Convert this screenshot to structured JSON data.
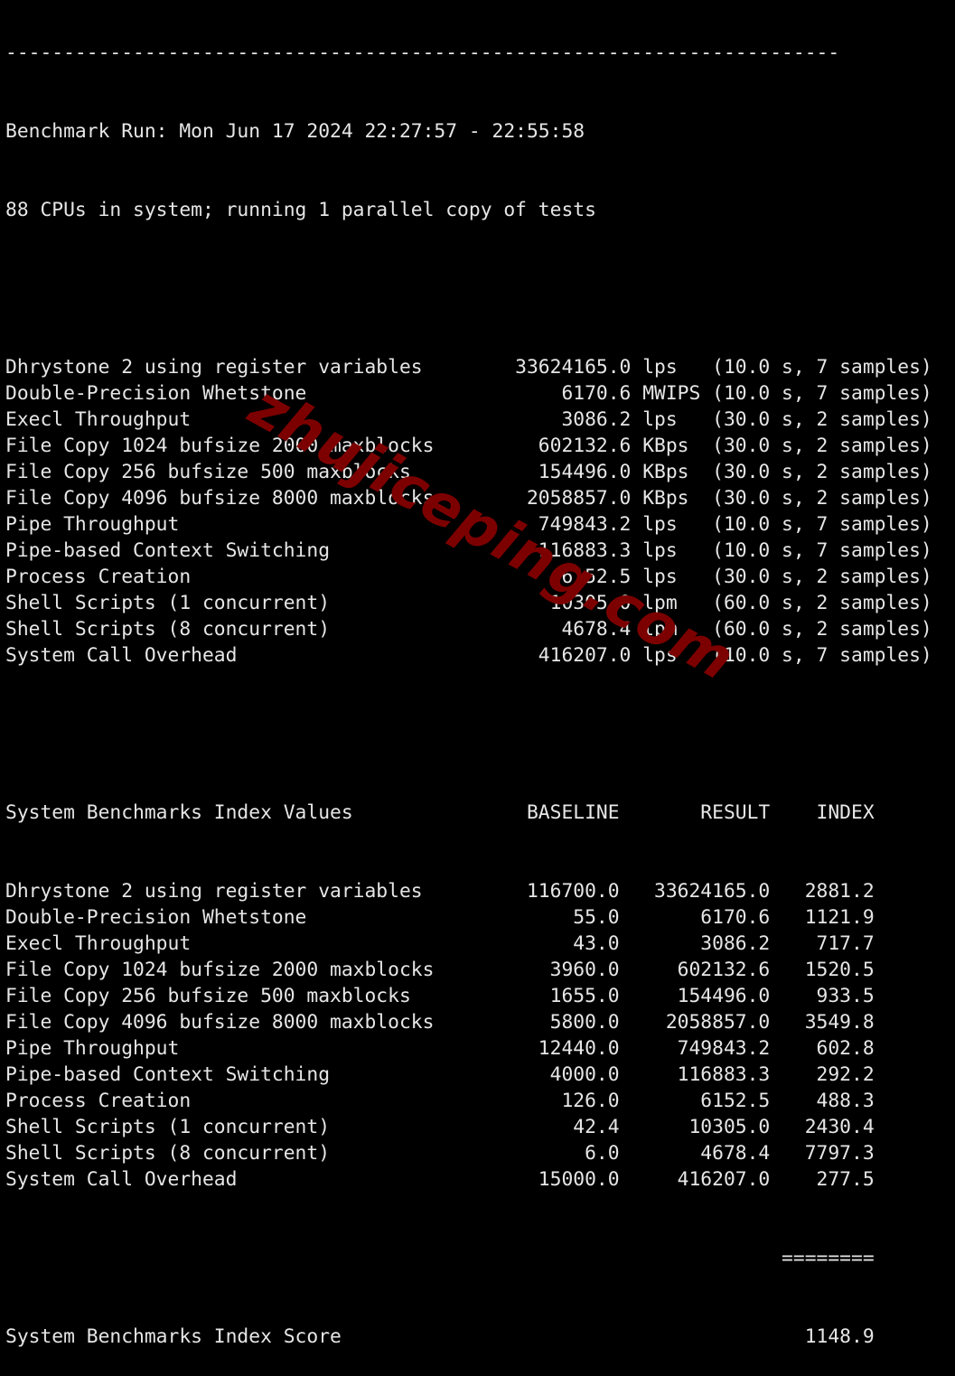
{
  "separator": "------------------------------------------------------------------------",
  "header": {
    "run_line": "Benchmark Run: Mon Jun 17 2024 22:27:57 - 22:55:58",
    "cpu_line": "88 CPUs in system; running 1 parallel copy of tests"
  },
  "raw_results": [
    {
      "name": "Dhrystone 2 using register variables",
      "value": "33624165.0",
      "unit": "lps",
      "time": "10.0 s",
      "samples": "7 samples"
    },
    {
      "name": "Double-Precision Whetstone",
      "value": "6170.6",
      "unit": "MWIPS",
      "time": "10.0 s",
      "samples": "7 samples"
    },
    {
      "name": "Execl Throughput",
      "value": "3086.2",
      "unit": "lps",
      "time": "30.0 s",
      "samples": "2 samples"
    },
    {
      "name": "File Copy 1024 bufsize 2000 maxblocks",
      "value": "602132.6",
      "unit": "KBps",
      "time": "30.0 s",
      "samples": "2 samples"
    },
    {
      "name": "File Copy 256 bufsize 500 maxblocks",
      "value": "154496.0",
      "unit": "KBps",
      "time": "30.0 s",
      "samples": "2 samples"
    },
    {
      "name": "File Copy 4096 bufsize 8000 maxblocks",
      "value": "2058857.0",
      "unit": "KBps",
      "time": "30.0 s",
      "samples": "2 samples"
    },
    {
      "name": "Pipe Throughput",
      "value": "749843.2",
      "unit": "lps",
      "time": "10.0 s",
      "samples": "7 samples"
    },
    {
      "name": "Pipe-based Context Switching",
      "value": "116883.3",
      "unit": "lps",
      "time": "10.0 s",
      "samples": "7 samples"
    },
    {
      "name": "Process Creation",
      "value": "6152.5",
      "unit": "lps",
      "time": "30.0 s",
      "samples": "2 samples"
    },
    {
      "name": "Shell Scripts (1 concurrent)",
      "value": "10305.0",
      "unit": "lpm",
      "time": "60.0 s",
      "samples": "2 samples"
    },
    {
      "name": "Shell Scripts (8 concurrent)",
      "value": "4678.4",
      "unit": "lpm",
      "time": "60.0 s",
      "samples": "2 samples"
    },
    {
      "name": "System Call Overhead",
      "value": "416207.0",
      "unit": "lps",
      "time": "10.0 s",
      "samples": "7 samples"
    }
  ],
  "index_table": {
    "title": "System Benchmarks Index Values",
    "columns": [
      "BASELINE",
      "RESULT",
      "INDEX"
    ],
    "rows": [
      {
        "name": "Dhrystone 2 using register variables",
        "baseline": "116700.0",
        "result": "33624165.0",
        "index": "2881.2"
      },
      {
        "name": "Double-Precision Whetstone",
        "baseline": "55.0",
        "result": "6170.6",
        "index": "1121.9"
      },
      {
        "name": "Execl Throughput",
        "baseline": "43.0",
        "result": "3086.2",
        "index": "717.7"
      },
      {
        "name": "File Copy 1024 bufsize 2000 maxblocks",
        "baseline": "3960.0",
        "result": "602132.6",
        "index": "1520.5"
      },
      {
        "name": "File Copy 256 bufsize 500 maxblocks",
        "baseline": "1655.0",
        "result": "154496.0",
        "index": "933.5"
      },
      {
        "name": "File Copy 4096 bufsize 8000 maxblocks",
        "baseline": "5800.0",
        "result": "2058857.0",
        "index": "3549.8"
      },
      {
        "name": "Pipe Throughput",
        "baseline": "12440.0",
        "result": "749843.2",
        "index": "602.8"
      },
      {
        "name": "Pipe-based Context Switching",
        "baseline": "4000.0",
        "result": "116883.3",
        "index": "292.2"
      },
      {
        "name": "Process Creation",
        "baseline": "126.0",
        "result": "6152.5",
        "index": "488.3"
      },
      {
        "name": "Shell Scripts (1 concurrent)",
        "baseline": "42.4",
        "result": "10305.0",
        "index": "2430.4"
      },
      {
        "name": "Shell Scripts (8 concurrent)",
        "baseline": "6.0",
        "result": "4678.4",
        "index": "7797.3"
      },
      {
        "name": "System Call Overhead",
        "baseline": "15000.0",
        "result": "416207.0",
        "index": "277.5"
      }
    ],
    "total_rule": "========",
    "score_label": "System Benchmarks Index Score",
    "score": "1148.9"
  },
  "watermark": "zhujiceping.com"
}
